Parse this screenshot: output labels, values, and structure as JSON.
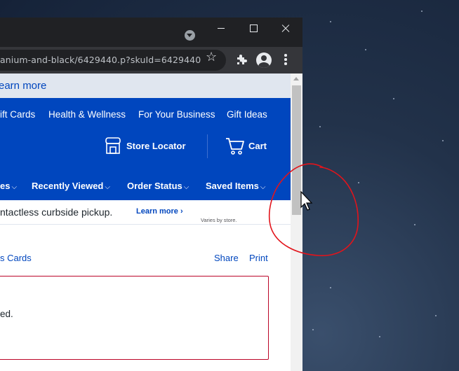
{
  "browser": {
    "address": "anium-and-black/6429440.p?skuId=6429440"
  },
  "page": {
    "learn_more_strip": "earn more",
    "nav_primary": [
      {
        "label": "ift Cards"
      },
      {
        "label": "Health & Wellness"
      },
      {
        "label": "For Your Business"
      },
      {
        "label": "Gift Ideas"
      }
    ],
    "store_locator": "Store Locator",
    "cart": "Cart",
    "nav_secondary": [
      {
        "label": "es"
      },
      {
        "label": "Recently Viewed"
      },
      {
        "label": "Order Status"
      },
      {
        "label": "Saved Items"
      }
    ],
    "promo_text": "ntactless curbside pickup.",
    "promo_link": "Learn more ›",
    "promo_note": "Varies by store.",
    "breadcrumb": "s Cards",
    "share": "Share",
    "print": "Print",
    "alert_text": "ed."
  },
  "colors": {
    "brand_blue": "#0046be",
    "alert_red": "#bb0628",
    "annotation_red": "#e2141b"
  }
}
